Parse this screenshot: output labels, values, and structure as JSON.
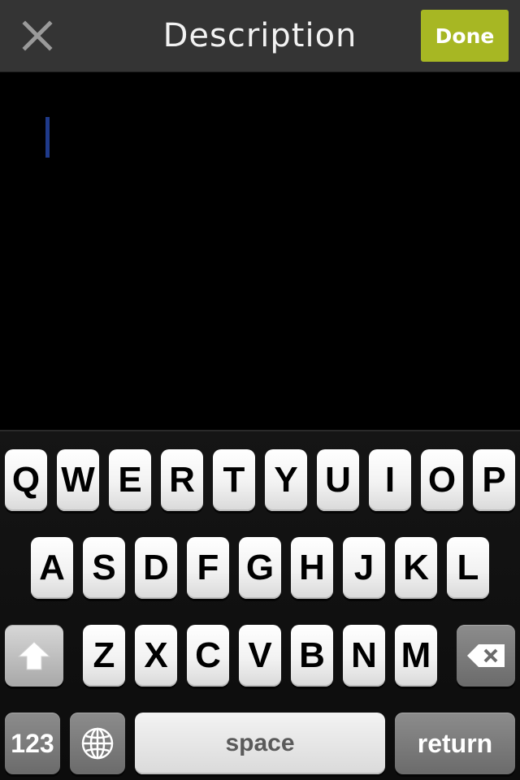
{
  "header": {
    "title": "Description",
    "close_icon": "close-x-icon",
    "done_label": "Done",
    "done_color": "#a7b723",
    "background_color": "#343434"
  },
  "editor": {
    "value": "",
    "caret_color": "#1f3a8a"
  },
  "keyboard": {
    "row1": [
      "Q",
      "W",
      "E",
      "R",
      "T",
      "Y",
      "U",
      "I",
      "O",
      "P"
    ],
    "row2": [
      "A",
      "S",
      "D",
      "F",
      "G",
      "H",
      "J",
      "K",
      "L"
    ],
    "row3": [
      "Z",
      "X",
      "C",
      "V",
      "B",
      "N",
      "M"
    ],
    "shift_icon": "shift-arrow-icon",
    "backspace_icon": "backspace-icon",
    "numbers_label": "123",
    "globe_icon": "globe-icon",
    "space_label": "space",
    "return_label": "return"
  }
}
